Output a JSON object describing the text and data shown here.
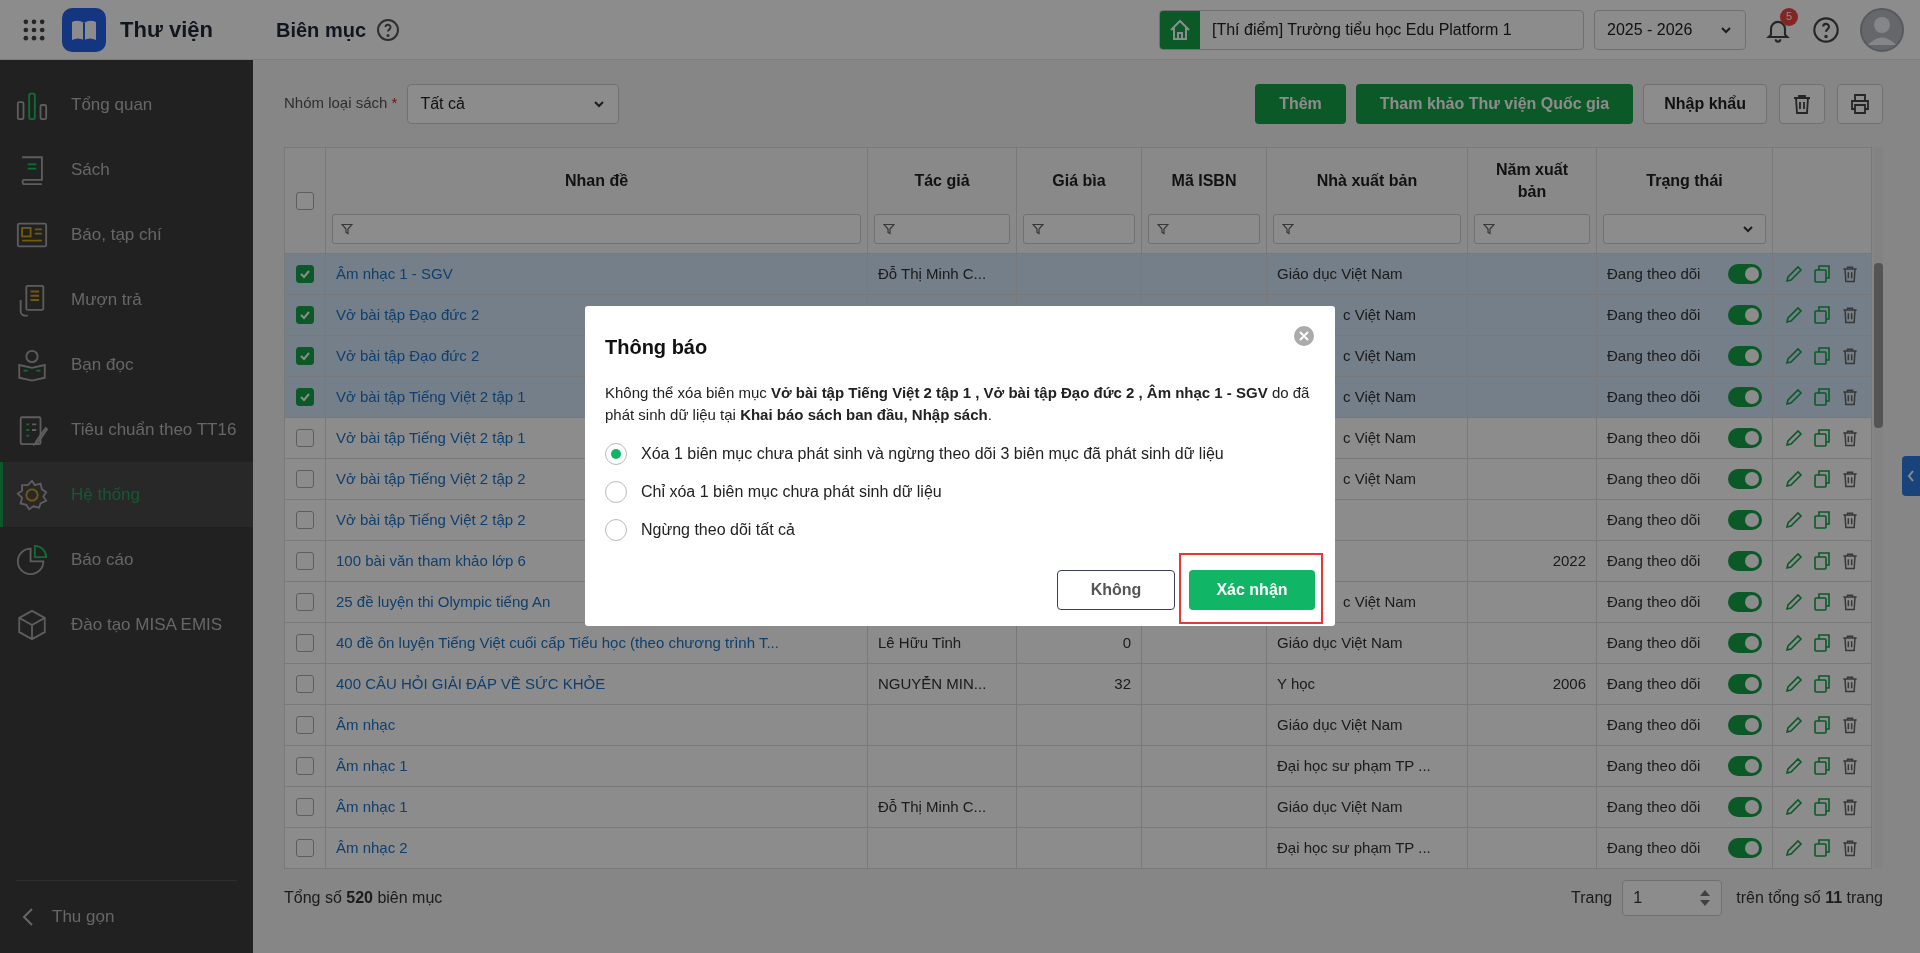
{
  "app": {
    "title": "Thư viện"
  },
  "page_title": "Biên mục",
  "header": {
    "school": "[Thí điểm] Trường tiểu học Edu Platform 1",
    "year": "2025 - 2026",
    "notification_count": "5"
  },
  "sidebar": {
    "items": [
      {
        "label": "Tổng quan",
        "selected": false
      },
      {
        "label": "Sách",
        "selected": false
      },
      {
        "label": "Báo, tạp chí",
        "selected": false
      },
      {
        "label": "Mượn trả",
        "selected": false
      },
      {
        "label": "Bạn đọc",
        "selected": false
      },
      {
        "label": "Tiêu chuẩn theo TT16",
        "selected": false
      },
      {
        "label": "Hệ thống",
        "selected": true
      },
      {
        "label": "Báo cáo",
        "selected": false
      },
      {
        "label": "Đào tạo MISA EMIS",
        "selected": false
      }
    ],
    "collapse": "Thu gọn"
  },
  "toolbar": {
    "filter_label": "Nhóm loại sách",
    "required_mark": "*",
    "filter_value": "Tất cả",
    "buttons": [
      {
        "label": "Thêm",
        "kind": "primary"
      },
      {
        "label": "Tham khảo Thư viện Quốc gia",
        "kind": "primary"
      },
      {
        "label": "Nhập khẩu",
        "kind": "secondary"
      }
    ]
  },
  "table": {
    "all_checked": false,
    "columns": [
      {
        "label": "Nhan đề",
        "kind": "text"
      },
      {
        "label": "Tác giả",
        "kind": "text"
      },
      {
        "label": "Giá bìa",
        "kind": "text"
      },
      {
        "label": "Mã ISBN",
        "kind": "text"
      },
      {
        "label": "Nhà xuất bản",
        "kind": "text"
      },
      {
        "label": "Năm xuất bản",
        "kind": "text"
      },
      {
        "label": "Trạng thái",
        "kind": "select"
      }
    ],
    "rows": [
      {
        "checked": true,
        "covered": false,
        "title": "Âm nhạc 1 - SGV",
        "author": "Đỗ Thị Minh C...",
        "publisher": "Giáo dục Việt Nam",
        "status": "Đang theo dõi",
        "tracking": true
      },
      {
        "checked": true,
        "covered": true,
        "title": "Vở bài tập Đạo đức 2",
        "publisher": "c Việt Nam",
        "status": "Đang theo dõi",
        "tracking": true
      },
      {
        "checked": true,
        "covered": true,
        "title": "Vở bài tập Đạo đức 2",
        "publisher": "c Việt Nam",
        "status": "Đang theo dõi",
        "tracking": true
      },
      {
        "checked": true,
        "covered": true,
        "title": "Vở bài tập Tiếng Việt 2 tập 1",
        "publisher": "c Việt Nam",
        "status": "Đang theo dõi",
        "tracking": true
      },
      {
        "checked": false,
        "covered": true,
        "title": "Vở bài tập Tiếng Việt 2 tập 1",
        "publisher": "c Việt Nam",
        "status": "Đang theo dõi",
        "tracking": true
      },
      {
        "checked": false,
        "covered": true,
        "title": "Vở bài tập Tiếng Việt 2 tập 2",
        "publisher": "c Việt Nam",
        "status": "Đang theo dõi",
        "tracking": true
      },
      {
        "checked": false,
        "covered": true,
        "title": "Vở bài tập Tiếng Việt 2 tập 2",
        "status": "Đang theo dõi",
        "tracking": true
      },
      {
        "checked": false,
        "covered": true,
        "title": "100 bài văn tham khảo lớp 6",
        "year": "2022",
        "status": "Đang theo dõi",
        "tracking": true
      },
      {
        "checked": false,
        "covered": true,
        "title": "25 đề luyện thi Olympic tiếng An",
        "publisher": "c Việt Nam",
        "status": "Đang theo dõi",
        "tracking": true
      },
      {
        "checked": false,
        "covered": false,
        "title": "40 đề ôn luyện Tiếng Việt cuối cấp Tiểu học (theo chương trình T...",
        "author": "Lê Hữu Tỉnh",
        "price": "0",
        "publisher": "Giáo dục Việt Nam",
        "status": "Đang theo dõi",
        "tracking": true
      },
      {
        "checked": false,
        "covered": false,
        "title": "400 CÂU HỎI GIẢI ĐÁP VỀ SỨC KHỎE",
        "author": "NGUYỄN MIN...",
        "price": "32",
        "publisher": "Y học",
        "year": "2006",
        "status": "Đang theo dõi",
        "tracking": true
      },
      {
        "checked": false,
        "covered": false,
        "title": "Âm nhạc",
        "publisher": "Giáo dục Việt Nam",
        "status": "Đang theo dõi",
        "tracking": true
      },
      {
        "checked": false,
        "covered": false,
        "title": "Âm nhạc 1",
        "publisher": "Đại học sư phạm TP ...",
        "status": "Đang theo dõi",
        "tracking": true
      },
      {
        "checked": false,
        "covered": false,
        "title": "Âm nhạc 1",
        "author": "Đỗ Thị Minh C...",
        "publisher": "Giáo dục Việt Nam",
        "status": "Đang theo dõi",
        "tracking": true
      },
      {
        "checked": false,
        "covered": false,
        "title": "Âm nhạc 2",
        "publisher": "Đại học sư phạm TP ...",
        "status": "Đang theo dõi",
        "tracking": true
      }
    ]
  },
  "footer": {
    "total": "Tổng số **520** biên mục",
    "page_label": "Trang",
    "page": "1",
    "page_total": "trên tổng số **11** trang"
  },
  "dialog": {
    "title": "Thông báo",
    "message": "Không thể xóa biên mục **Vở bài tập Tiếng Việt 2 tập 1 , Vở bài tập Đạo đức 2 , Âm nhạc 1 - SGV** do đã phát sinh dữ liệu tại **Khai báo sách ban đầu, Nhập sách**.",
    "options": [
      {
        "label": "Xóa 1 biên mục chưa phát sinh và ngừng theo dõi 3 biên mục đã phát sinh dữ liệu",
        "selected": true
      },
      {
        "label": "Chỉ xóa 1 biên mục chưa phát sinh dữ liệu",
        "selected": false
      },
      {
        "label": "Ngừng theo dõi tất cả",
        "selected": false
      }
    ],
    "buttons": [
      {
        "label": "Không",
        "kind": "secondary"
      },
      {
        "label": "Xác nhận",
        "kind": "primary"
      }
    ]
  }
}
